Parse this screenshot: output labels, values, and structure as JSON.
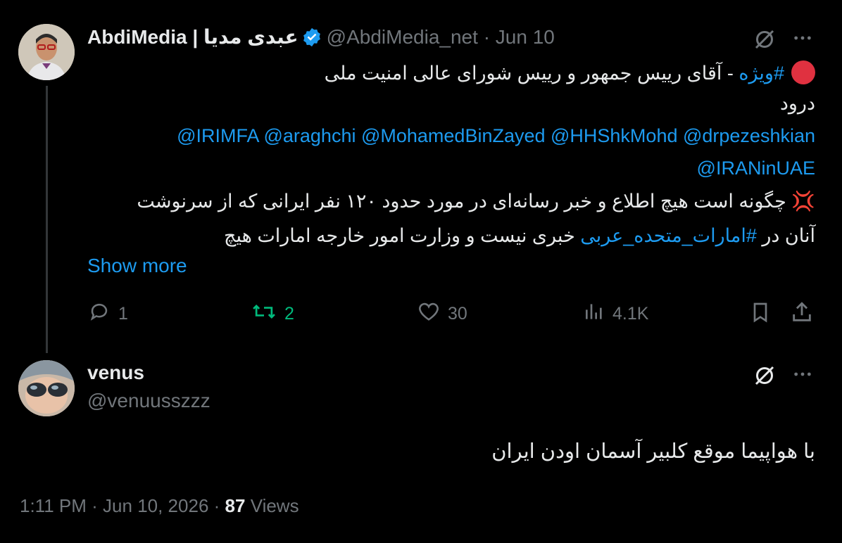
{
  "tweet": {
    "author_name": "AbdiMedia | عبدی مدیا",
    "author_handle": "@AbdiMedia_net",
    "separator": "·",
    "date": "Jun 10",
    "line1_hashtag": "#ویژه",
    "line1_text": " - آقای رییس جمهور و رییس شورای عالی امنیت ملی",
    "line2": "درود",
    "mentions_line1": "@IRIMFA @araghchi @MohamedBinZayed @HHShkMohd @drpezeshkian",
    "mentions_line2": "@IRANinUAE",
    "line5": "💢 چگونه است هیچ اطلاع و خبر رسانه‌ای در مورد حدود ۱۲۰ نفر ایرانی که از سرنوشت",
    "line6_pre": "آنان در ",
    "line6_hashtag": "#امارات_متحده_عربی",
    "line6_post": " خبری نیست و وزارت امور خارجه امارات هیچ",
    "show_more": "Show more",
    "replies": "1",
    "retweets": "2",
    "likes": "30",
    "views": "4.1K",
    "accent_color": "#1d9bf0",
    "retweet_color": "#00ba7c"
  },
  "reply": {
    "author_name": "venus",
    "author_handle": "@venuusszzz",
    "text": "با هواپیما موقع کلبیر آسمان اودن ایران",
    "time": "1:11 PM",
    "separator": "·",
    "date": "Jun 10, 2026",
    "views_count": "87",
    "views_label": "Views"
  },
  "icons": [
    "grok-icon",
    "more-icon",
    "reply-icon",
    "retweet-icon",
    "like-icon",
    "views-icon",
    "bookmark-icon",
    "share-icon",
    "verified-badge-icon"
  ]
}
